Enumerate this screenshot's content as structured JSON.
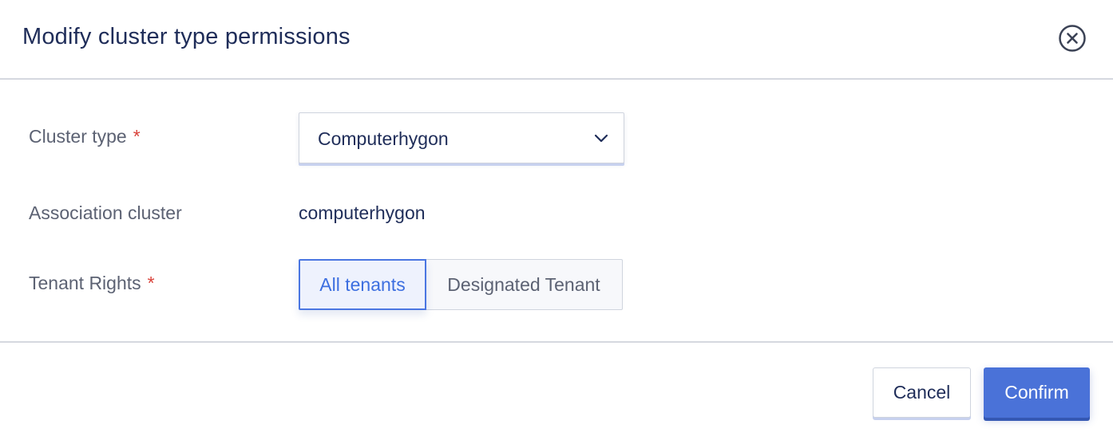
{
  "dialog": {
    "title": "Modify cluster type permissions",
    "close_icon": "close-circle-icon"
  },
  "form": {
    "cluster_type": {
      "label": "Cluster type",
      "required_mark": "*",
      "selected_value": "Computerhygon",
      "dropdown_icon": "chevron-down-icon"
    },
    "association_cluster": {
      "label": "Association cluster",
      "value": "computerhygon"
    },
    "tenant_rights": {
      "label": "Tenant Rights",
      "required_mark": "*",
      "options": [
        "All tenants",
        "Designated Tenant"
      ],
      "selected": "All tenants"
    }
  },
  "footer": {
    "cancel_label": "Cancel",
    "confirm_label": "Confirm"
  },
  "colors": {
    "title_text": "#1f2d59",
    "label_text": "#5c6273",
    "required": "#d9423a",
    "primary": "#4a72d8",
    "selected_segment_bg": "#eef2fd",
    "selected_segment_text": "#3d6fe0",
    "divider": "#d5d8df"
  }
}
